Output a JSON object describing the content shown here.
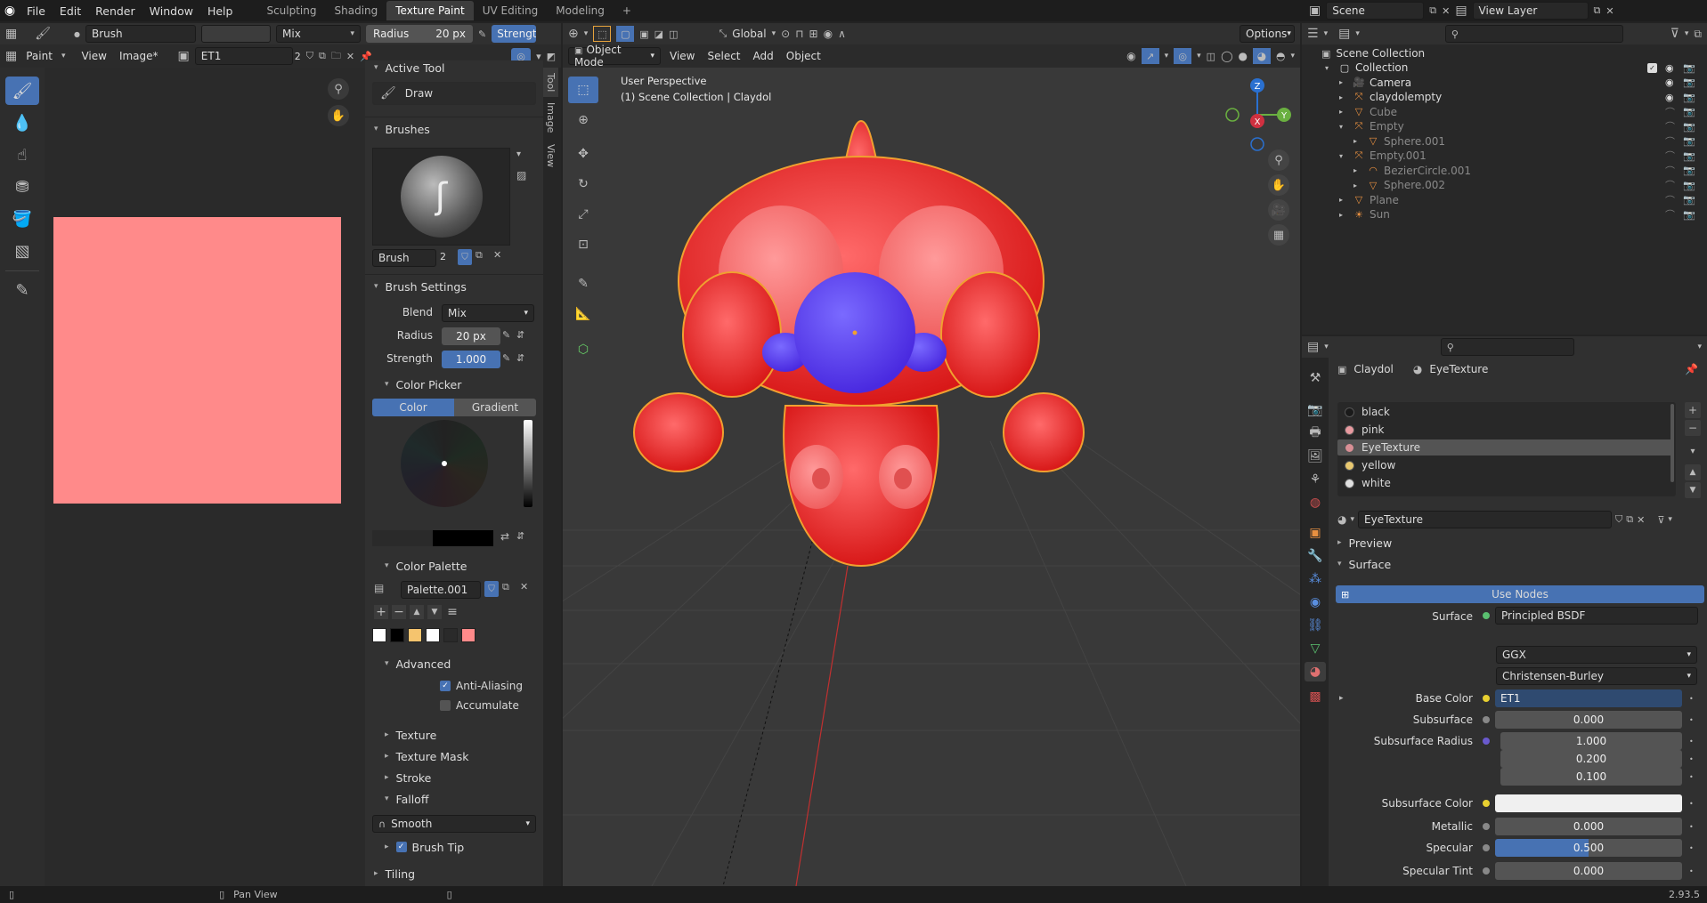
{
  "topbar": {
    "menus": [
      "File",
      "Edit",
      "Render",
      "Window",
      "Help"
    ],
    "workspaces": [
      "Sculpting",
      "Shading",
      "Texture Paint",
      "UV Editing",
      "Modeling"
    ],
    "active_workspace": "Texture Paint",
    "add_tab": "+",
    "scene_label": "Scene",
    "view_layer_label": "View Layer"
  },
  "tool_header": {
    "brush_name": "Brush",
    "blend": "Mix",
    "radius_label": "Radius",
    "radius_value": "20 px",
    "strength_label": "Strength",
    "options": "Options"
  },
  "image_editor": {
    "mode": "Paint",
    "menus": [
      "View",
      "Image*"
    ],
    "image_name": "ET1",
    "users": "2",
    "tabs": [
      "Tool",
      "Image",
      "View"
    ],
    "canvas_color": "#ff8a8a"
  },
  "tool_panel": {
    "active_tool_header": "Active Tool",
    "active_tool": "Draw",
    "brushes_header": "Brushes",
    "brush_name": "Brush",
    "brush_users": "2",
    "brush_settings_header": "Brush Settings",
    "blend_label": "Blend",
    "blend_value": "Mix",
    "radius_label": "Radius",
    "radius_value": "20 px",
    "strength_label": "Strength",
    "strength_value": "1.000",
    "color_picker_header": "Color Picker",
    "color_tab": "Color",
    "gradient_tab": "Gradient",
    "color_palette_header": "Color Palette",
    "palette_name": "Palette.001",
    "palette_swatches": [
      "#ffffff",
      "#000000",
      "#f5c46e",
      "#ffffff",
      "#2a2a2a",
      "#ff8a8a"
    ],
    "advanced_header": "Advanced",
    "anti_aliasing": "Anti-Aliasing",
    "accumulate": "Accumulate",
    "texture": "Texture",
    "texture_mask": "Texture Mask",
    "stroke": "Stroke",
    "falloff": "Falloff",
    "falloff_value": "Smooth",
    "brush_tip": "Brush Tip",
    "tiling": "Tiling"
  },
  "viewport": {
    "mode": "Object Mode",
    "menus": [
      "View",
      "Select",
      "Add",
      "Object"
    ],
    "orientation": "Global",
    "options": "Options",
    "info_line1": "User Perspective",
    "info_line2": "(1) Scene Collection | Claydol",
    "gizmo_axes": [
      "Z",
      "Y",
      "X"
    ]
  },
  "outliner": {
    "root": "Scene Collection",
    "items": [
      {
        "label": "Collection",
        "indent": 0,
        "active": true
      },
      {
        "label": "Camera",
        "indent": 1,
        "active": true
      },
      {
        "label": "claydolempty",
        "indent": 1,
        "active": true
      },
      {
        "label": "Cube",
        "indent": 1,
        "active": false
      },
      {
        "label": "Empty",
        "indent": 1,
        "active": false
      },
      {
        "label": "Sphere.001",
        "indent": 2,
        "active": false
      },
      {
        "label": "Empty.001",
        "indent": 1,
        "active": false
      },
      {
        "label": "BezierCircle.001",
        "indent": 2,
        "active": false
      },
      {
        "label": "Sphere.002",
        "indent": 2,
        "active": false
      },
      {
        "label": "Plane",
        "indent": 1,
        "active": false
      },
      {
        "label": "Sun",
        "indent": 1,
        "active": false
      }
    ]
  },
  "properties": {
    "object_name": "Claydol",
    "material_name": "EyeTexture",
    "material_slots": [
      {
        "name": "black",
        "color": "#1a1a1a"
      },
      {
        "name": "pink",
        "color": "#e89aa0"
      },
      {
        "name": "EyeTexture",
        "color": "#d88f95"
      },
      {
        "name": "yellow",
        "color": "#e8c870"
      },
      {
        "name": "white",
        "color": "#e0e0e0"
      }
    ],
    "active_slot": "EyeTexture",
    "preview": "Preview",
    "surface_header": "Surface",
    "use_nodes": "Use Nodes",
    "surface_label": "Surface",
    "surface_value": "Principled BSDF",
    "distribution": "GGX",
    "subsurface_method": "Christensen-Burley",
    "rows": [
      {
        "label": "Base Color",
        "value": "ET1",
        "dot": "#e8d030"
      },
      {
        "label": "Subsurface",
        "value": "0.000",
        "dot": "#888888"
      },
      {
        "label": "Subsurface Radius",
        "value": "1.000",
        "dot": "#6a5acd"
      },
      {
        "label": "",
        "value": "0.200",
        "dot": ""
      },
      {
        "label": "",
        "value": "0.100",
        "dot": ""
      },
      {
        "label": "Subsurface Color",
        "value": "",
        "dot": "#e8d030"
      },
      {
        "label": "Metallic",
        "value": "0.000",
        "dot": "#888888"
      },
      {
        "label": "Specular",
        "value": "0.500",
        "dot": "#888888"
      },
      {
        "label": "Specular Tint",
        "value": "0.000",
        "dot": "#888888"
      }
    ]
  },
  "statusbar": {
    "pan_view": "Pan View",
    "version": "2.93.5"
  }
}
